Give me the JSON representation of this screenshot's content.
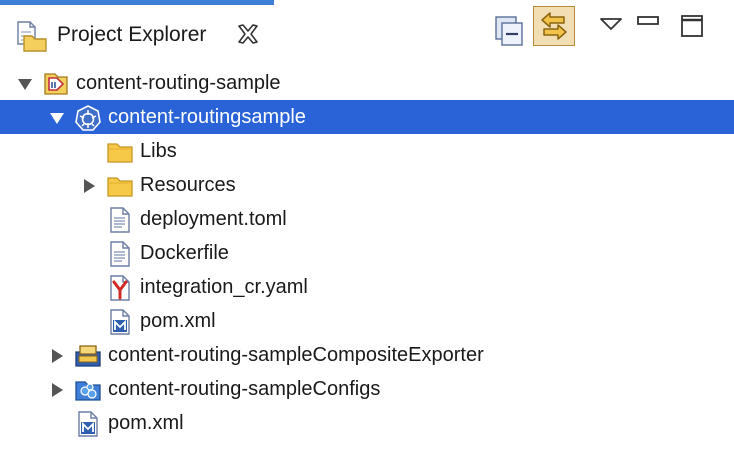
{
  "view": {
    "title": "Project Explorer",
    "accent_color": "#3f7fd7",
    "selection_color": "#2a63d8"
  },
  "toolbar": {
    "collapse_all": "collapse-all-icon",
    "link_with_editor": "link-with-editor-icon",
    "view_menu": "view-menu-icon",
    "minimize": "minimize-icon",
    "maximize": "maximize-icon"
  },
  "tree": {
    "rows": [
      {
        "label": "content-routing-sample",
        "icon": "integration-project-icon",
        "twisty": "expanded",
        "selected": false
      },
      {
        "label": "content-routingsample",
        "icon": "kubernetes-project-icon",
        "twisty": "expanded",
        "selected": true
      },
      {
        "label": "Libs",
        "icon": "folder-icon",
        "twisty": "none",
        "selected": false
      },
      {
        "label": "Resources",
        "icon": "folder-icon",
        "twisty": "collapsed",
        "selected": false
      },
      {
        "label": "deployment.toml",
        "icon": "text-file-icon",
        "twisty": "none",
        "selected": false
      },
      {
        "label": "Dockerfile",
        "icon": "text-file-icon",
        "twisty": "none",
        "selected": false
      },
      {
        "label": "integration_cr.yaml",
        "icon": "yaml-file-icon",
        "twisty": "none",
        "selected": false
      },
      {
        "label": "pom.xml",
        "icon": "maven-file-icon",
        "twisty": "none",
        "selected": false
      },
      {
        "label": "content-routing-sampleCompositeExporter",
        "icon": "composite-exporter-icon",
        "twisty": "collapsed",
        "selected": false
      },
      {
        "label": "content-routing-sampleConfigs",
        "icon": "configs-project-icon",
        "twisty": "collapsed",
        "selected": false
      },
      {
        "label": "pom.xml",
        "icon": "maven-file-icon",
        "twisty": "none",
        "selected": false
      }
    ]
  }
}
